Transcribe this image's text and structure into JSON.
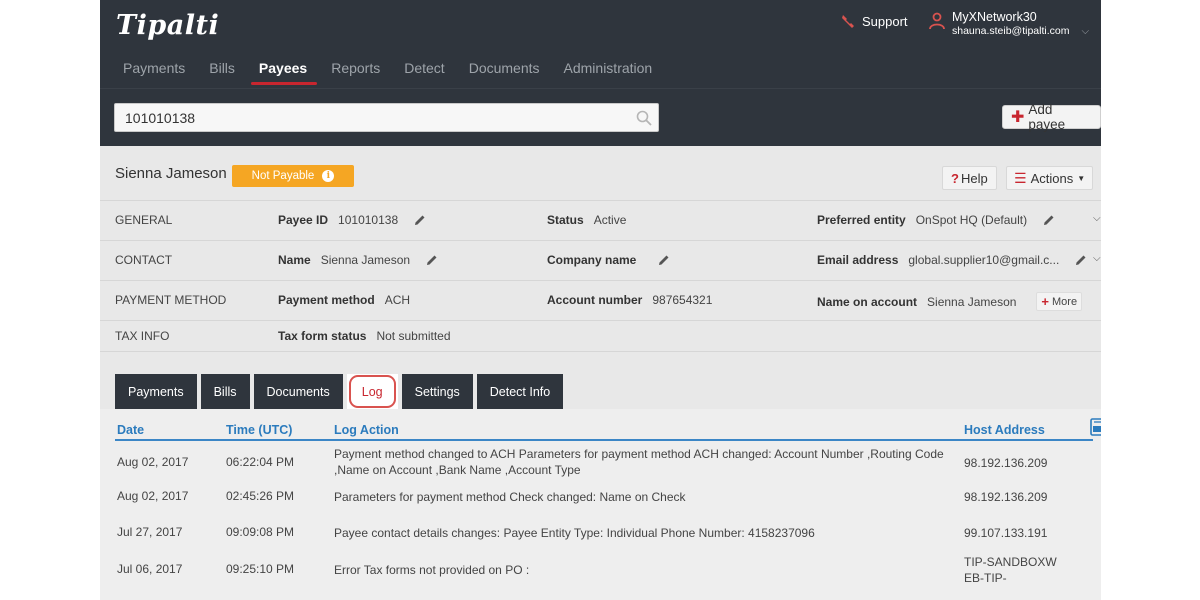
{
  "header": {
    "logo": "Tipalti",
    "support_label": "Support",
    "user_name": "MyXNetwork30",
    "user_email": "shauna.steib@tipalti.com"
  },
  "nav": {
    "items": [
      "Payments",
      "Bills",
      "Payees",
      "Reports",
      "Detect",
      "Documents",
      "Administration"
    ],
    "active": "Payees"
  },
  "search": {
    "value": "101010138"
  },
  "add_payee_label": "Add payee",
  "payee": {
    "name": "Sienna Jameson",
    "status": "Not Payable"
  },
  "buttons": {
    "help": "Help",
    "actions": "Actions",
    "more": "More"
  },
  "general": {
    "section": "GENERAL",
    "payee_id_label": "Payee ID",
    "payee_id": "101010138",
    "status_label": "Status",
    "status": "Active",
    "entity_label": "Preferred entity",
    "entity": "OnSpot HQ (Default)"
  },
  "contact": {
    "section": "CONTACT",
    "name_label": "Name",
    "name": "Sienna Jameson",
    "company_label": "Company name",
    "email_label": "Email address",
    "email": "global.supplier10@gmail.c..."
  },
  "payment": {
    "section": "PAYMENT METHOD",
    "method_label": "Payment method",
    "method": "ACH",
    "account_label": "Account number",
    "account": "987654321",
    "name_on_account_label": "Name on account",
    "name_on_account": "Sienna Jameson"
  },
  "tax": {
    "section": "TAX INFO",
    "form_label": "Tax form status",
    "form": "Not submitted"
  },
  "tabs": {
    "items": [
      "Payments",
      "Bills",
      "Documents",
      "Log",
      "Settings",
      "Detect Info"
    ],
    "active": "Log"
  },
  "log": {
    "columns": {
      "date": "Date",
      "time": "Time (UTC)",
      "action": "Log Action",
      "host": "Host Address"
    },
    "rows": [
      {
        "date": "Aug 02, 2017",
        "time": "06:22:04 PM",
        "action": "Payment method changed to ACH Parameters for payment method ACH changed: Account Number ,Routing Code ,Name on Account ,Bank Name ,Account Type",
        "host": "98.192.136.209"
      },
      {
        "date": "Aug 02, 2017",
        "time": "02:45:26 PM",
        "action": "Parameters for payment method Check changed: Name on Check",
        "host": "98.192.136.209"
      },
      {
        "date": "Jul 27, 2017",
        "time": "09:09:08 PM",
        "action": "Payee contact details changes: Payee Entity Type: Individual Phone Number: 4158237096",
        "host": "99.107.133.191"
      },
      {
        "date": "Jul 06, 2017",
        "time": "09:25:10 PM",
        "action": "Error Tax forms not provided on PO :",
        "host": "TIP-SANDBOXWEB-TIP-"
      }
    ]
  },
  "colors": {
    "accent": "#c8262f",
    "header_bg": "#2f353d",
    "status_orange": "#f5a623",
    "link_blue": "#2b7bbd"
  }
}
